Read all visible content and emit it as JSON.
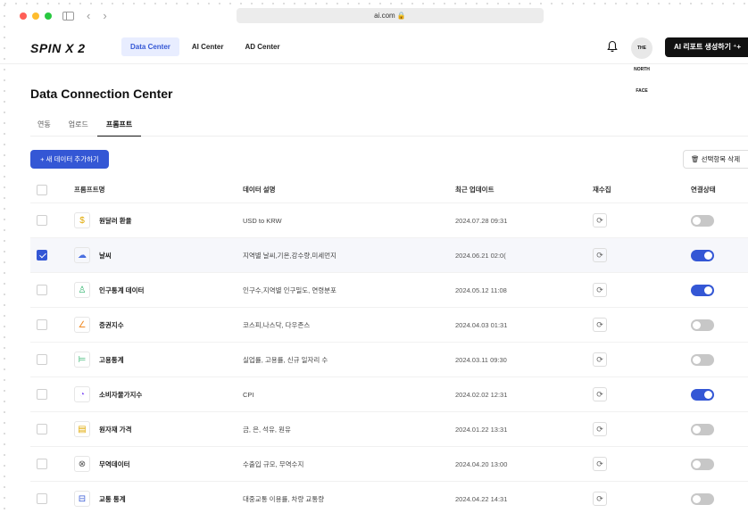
{
  "browser": {
    "url": "ai.com 🔒"
  },
  "app": {
    "logo": "SPIN X 2"
  },
  "nav": {
    "tabs": [
      {
        "label": "Data Center",
        "active": true
      },
      {
        "label": "AI Center",
        "active": false
      },
      {
        "label": "AD Center",
        "active": false
      }
    ],
    "avatar_text": "THE NORTH FACE",
    "ai_button_label": "AI 리포트 생성하기 ⁺+"
  },
  "page": {
    "title": "Data Connection Center",
    "sub_tabs": [
      {
        "label": "연동",
        "active": false
      },
      {
        "label": "업로드",
        "active": false
      },
      {
        "label": "프롬프트",
        "active": true
      }
    ],
    "add_button_label": "+ 새 데이터 추가하기",
    "delete_button_label": "🗑 선택항목 삭제"
  },
  "table": {
    "headers": {
      "name": "프롬프트명",
      "desc": "데이터 설명",
      "date": "최근 업데이트",
      "sync": "재수집",
      "status": "연결상태"
    },
    "rows": [
      {
        "icon": "$",
        "icon_color": "#e0a800",
        "name": "원달러 환율",
        "desc": "USD to KRW",
        "date": "2024.07.28 09:31",
        "checked": false,
        "on": false
      },
      {
        "icon": "☁",
        "icon_color": "#4a6fe0",
        "name": "날씨",
        "desc": "지역별 날씨,기온,강수량,미세먼지",
        "date": "2024.06.21 02:0(",
        "checked": true,
        "on": true
      },
      {
        "icon": "♙",
        "icon_color": "#2db36b",
        "name": "인구통계 데이터",
        "desc": "인구수,지역별 인구밀도, 연령분포",
        "date": "2024.05.12 11:08",
        "checked": false,
        "on": true
      },
      {
        "icon": "∠",
        "icon_color": "#f08a24",
        "name": "증권지수",
        "desc": "코스피,나스닥, 다우존스",
        "date": "2024.04.03 01:31",
        "checked": false,
        "on": false
      },
      {
        "icon": "⊨",
        "icon_color": "#2db36b",
        "name": "고용통계",
        "desc": "실업률, 고용률, 신규 일자리 수",
        "date": "2024.03.11 09:30",
        "checked": false,
        "on": false
      },
      {
        "icon": "◔",
        "icon_color": "#8b5cf6",
        "name": "소비자물가지수",
        "desc": "CPI",
        "date": "2024.02.02 12:31",
        "checked": false,
        "on": true
      },
      {
        "icon": "▤",
        "icon_color": "#e0a800",
        "name": "원자재 가격",
        "desc": "금, 은, 석유, 원유",
        "date": "2024.01.22 13:31",
        "checked": false,
        "on": false
      },
      {
        "icon": "⊗",
        "icon_color": "#555555",
        "name": "무역데이터",
        "desc": "수출입 규모, 무역수지",
        "date": "2024.04.20 13:00",
        "checked": false,
        "on": false
      },
      {
        "icon": "⊟",
        "icon_color": "#3457d5",
        "name": "교통 통계",
        "desc": "대중교통 이용률, 차량 교통량",
        "date": "2024.04.22 14:31",
        "checked": false,
        "on": false
      }
    ]
  }
}
